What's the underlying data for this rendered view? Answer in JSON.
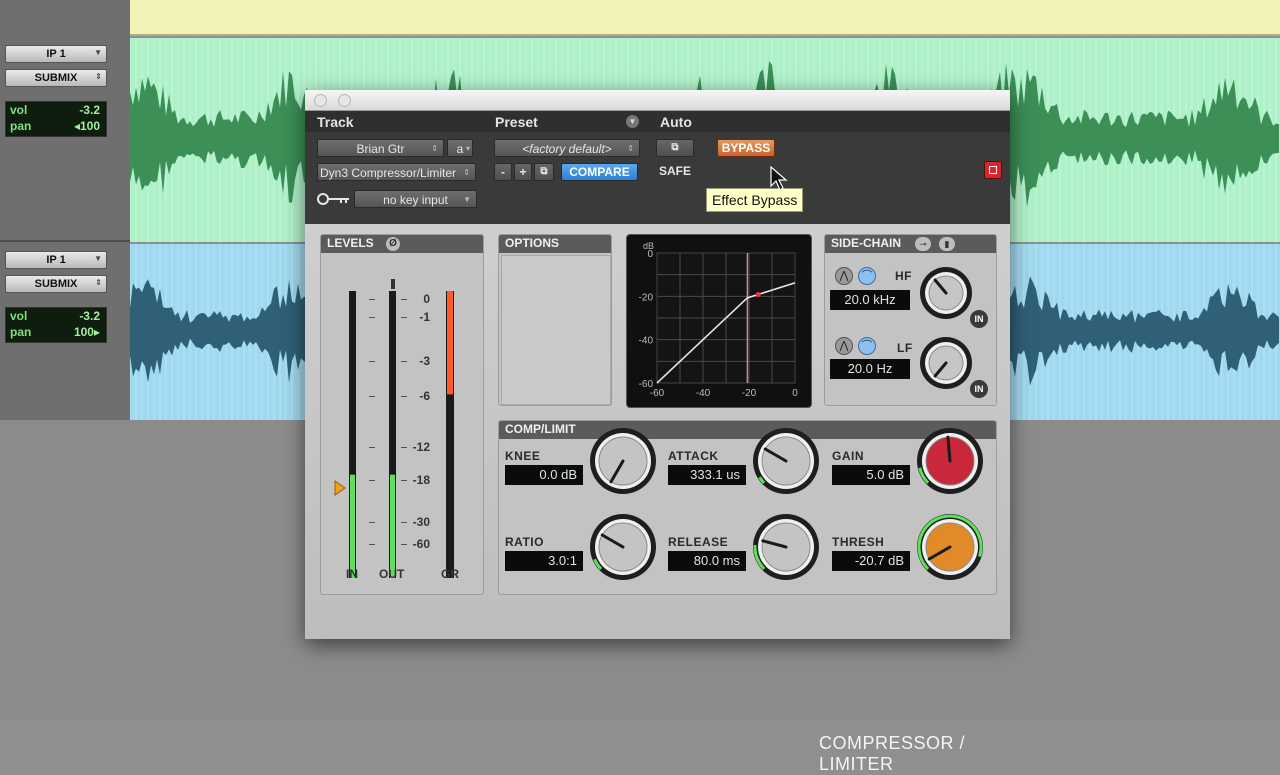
{
  "tracks": [
    {
      "name": "IP 1",
      "output": "SUBMIX",
      "vol_label": "vol",
      "vol": "-3.2",
      "pan_label": "pan",
      "pan": "◂100"
    },
    {
      "name": "IP 1",
      "output": "SUBMIX",
      "vol_label": "vol",
      "vol": "-3.2",
      "pan_label": "pan",
      "pan": "100▸"
    }
  ],
  "plugin": {
    "header": {
      "track_label": "Track",
      "preset_label": "Preset",
      "auto_label": "Auto",
      "track_name": "Brian Gtr",
      "track_channel": "a",
      "plugin_name": "Dyn3 Compressor/Limiter",
      "preset_name": "<factory default>",
      "minus": "-",
      "plus": "+",
      "compare": "COMPARE",
      "safe": "SAFE",
      "bypass": "BYPASS",
      "bypass_tooltip": "Effect Bypass",
      "key_input": "no key input"
    },
    "levels": {
      "title": "LEVELS",
      "in_label": "IN",
      "out_label": "OUT",
      "gr_label": "GR",
      "scale": [
        "0",
        "-1",
        "-3",
        "-6",
        "-12",
        "-18",
        "-30",
        "-60"
      ],
      "in_level": 0.36,
      "out_level": 0.36,
      "gr_level": 0.36
    },
    "options": {
      "title": "OPTIONS"
    },
    "graph": {
      "unit": "dB",
      "y_ticks": [
        "0",
        "-20",
        "-40",
        "-60"
      ],
      "x_ticks": [
        "-60",
        "-40",
        "-20",
        "0"
      ],
      "threshold": -20.7,
      "ratio": 3.0
    },
    "sidechain": {
      "title": "SIDE-CHAIN",
      "hf_label": "HF",
      "hf_value": "20.0 kHz",
      "lf_label": "LF",
      "lf_value": "20.0 Hz",
      "in_label": "IN"
    },
    "comp": {
      "title": "COMP/LIMIT",
      "knee_label": "KNEE",
      "knee": "0.0 dB",
      "attack_label": "ATTACK",
      "attack": "333.1 us",
      "gain_label": "GAIN",
      "gain": "5.0 dB",
      "ratio_label": "RATIO",
      "ratio": "3.0:1",
      "release_label": "RELEASE",
      "release": "80.0 ms",
      "thresh_label": "THRESH",
      "thresh": "-20.7 dB"
    },
    "brand": "COMPRESSOR / LIMITER",
    "colors": {
      "bypass": "#d0703a",
      "compare": "#3a8fe0",
      "gain_knob": "#c8283a",
      "thresh_knob": "#e08a2a",
      "meter_green": "#5fe05a",
      "meter_red": "#ff5a2a"
    }
  }
}
